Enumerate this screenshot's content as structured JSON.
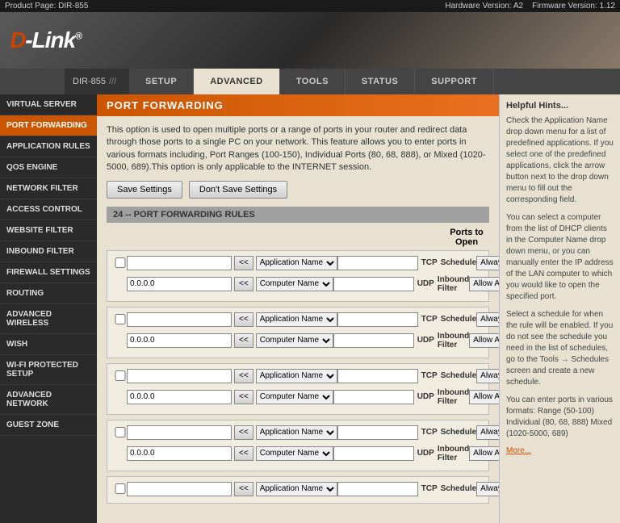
{
  "topbar": {
    "product": "Product Page: DIR-855",
    "hardware": "Hardware Version: A2",
    "firmware": "Firmware Version: 1.12"
  },
  "header": {
    "logo_d": "D",
    "logo_link": "-Link",
    "logo_tm": "®"
  },
  "breadcrumb": "DIR-855",
  "nav": {
    "tabs": [
      {
        "id": "setup",
        "label": "SETUP"
      },
      {
        "id": "advanced",
        "label": "ADVANCED",
        "active": true
      },
      {
        "id": "tools",
        "label": "TOOLS"
      },
      {
        "id": "status",
        "label": "STATUS"
      },
      {
        "id": "support",
        "label": "SUPPORT"
      }
    ]
  },
  "sidebar": {
    "items": [
      {
        "id": "virtual-server",
        "label": "VIRTUAL SERVER"
      },
      {
        "id": "port-forwarding",
        "label": "PORT FORWARDING",
        "active": true
      },
      {
        "id": "application-rules",
        "label": "APPLICATION RULES"
      },
      {
        "id": "qos-engine",
        "label": "QOS ENGINE"
      },
      {
        "id": "network-filter",
        "label": "NETWORK FILTER"
      },
      {
        "id": "access-control",
        "label": "ACCESS CONTROL"
      },
      {
        "id": "website-filter",
        "label": "WEBSITE FILTER"
      },
      {
        "id": "inbound-filter",
        "label": "INBOUND FILTER"
      },
      {
        "id": "firewall-settings",
        "label": "FIREWALL SETTINGS"
      },
      {
        "id": "routing",
        "label": "ROUTING"
      },
      {
        "id": "advanced-wireless",
        "label": "ADVANCED WIRELESS"
      },
      {
        "id": "wish",
        "label": "WISH"
      },
      {
        "id": "wifi-protected",
        "label": "WI-FI PROTECTED SETUP"
      },
      {
        "id": "advanced-network",
        "label": "ADVANCED NETWORK"
      },
      {
        "id": "guest-zone",
        "label": "GUEST ZONE"
      }
    ]
  },
  "content": {
    "title": "PORT FORWARDING",
    "description": "This option is used to open multiple ports or a range of ports in your router and redirect data through those ports to a single PC on your network. This feature allows you to enter ports in various formats including, Port Ranges (100-150), Individual Ports (80, 68, 888), or Mixed (1020-5000, 689).This option is only applicable to the INTERNET session.",
    "save_btn": "Save Settings",
    "dont_save_btn": "Don't Save Settings",
    "rules_header": "24 -- PORT FORWARDING RULES",
    "ports_to_open": "Ports to Open",
    "tcp_label": "TCP",
    "udp_label": "UDP",
    "schedule_label": "Schedule",
    "always_label": "Always",
    "inbound_label": "Inbound Filter",
    "allow_all_label": "Allow All",
    "name_placeholder": "",
    "ip_default": "0.0.0.0",
    "app_name": "Application Name",
    "comp_name": "Computer Name",
    "arrow_btn": "<<"
  },
  "hints": {
    "title": "Helpful Hints...",
    "paragraphs": [
      "Check the Application Name drop down menu for a list of predefined applications. If you select one of the predefined applications, click the arrow button next to the drop down menu to fill out the corresponding field.",
      "You can select a computer from the list of DHCP clients in the Computer Name drop down menu, or you can manually enter the IP address of the LAN computer to which you would like to open the specified port.",
      "Select a schedule for when the rule will be enabled. If you do not see the schedule you need in the list of schedules, go to the Tools → Schedules screen and create a new schedule.",
      "You can enter ports in various formats:\n\nRange (50-100)\nIndividual (80, 68, 888)\nMixed (1020-5000, 689)"
    ],
    "more_label": "More..."
  }
}
